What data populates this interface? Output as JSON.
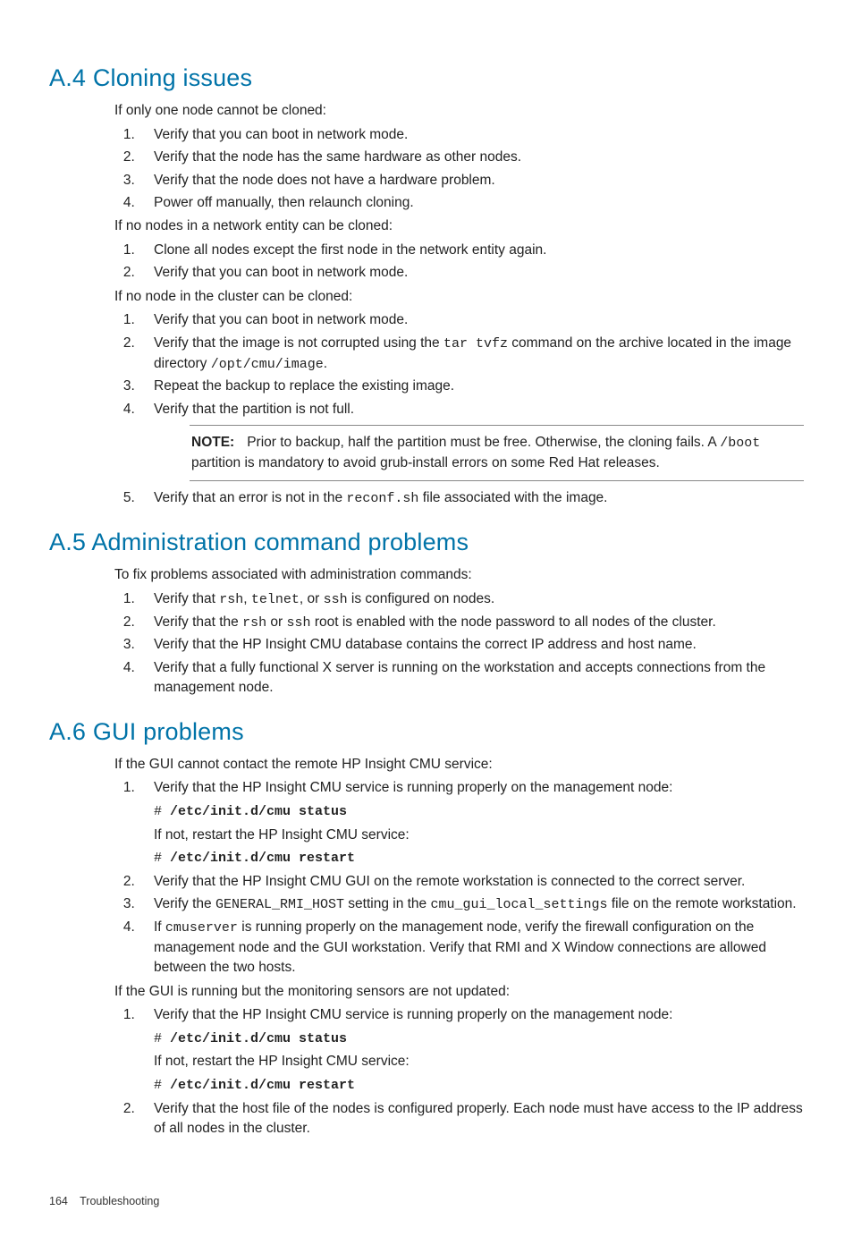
{
  "a4": {
    "heading": "A.4 Cloning issues",
    "p1": "If only one node cannot be cloned:",
    "l1": [
      "Verify that you can boot in network mode.",
      "Verify that the node has the same hardware as other nodes.",
      "Verify that the node does not have a hardware problem.",
      "Power off manually, then relaunch cloning."
    ],
    "p2": "If no nodes in a network entity can be cloned:",
    "l2": [
      "Clone all nodes except the first node in the network entity again.",
      "Verify that you can boot in network mode."
    ],
    "p3": "If no node in the cluster can be cloned:",
    "l3_1": "Verify that you can boot in network mode.",
    "l3_2a": "Verify that the image is not corrupted using the ",
    "l3_2cmd1": "tar tvfz",
    "l3_2b": " command on the archive located in the image directory ",
    "l3_2cmd2": "/opt/cmu/image",
    "l3_2c": ".",
    "l3_3": "Repeat the backup to replace the existing image.",
    "l3_4": "Verify that the partition is not full.",
    "note_label": "NOTE:",
    "note_a": "Prior to backup, half the partition must be free. Otherwise, the cloning fails. A ",
    "note_cmd": "/boot",
    "note_b": " partition is mandatory to avoid grub-install errors on some Red Hat releases.",
    "l3_5a": "Verify that an error is not in the ",
    "l3_5cmd": "reconf.sh",
    "l3_5b": " file associated with the image."
  },
  "a5": {
    "heading": "A.5 Administration command problems",
    "p1": "To fix problems associated with administration commands:",
    "i1a": "Verify that ",
    "i1c1": "rsh",
    "i1b": ", ",
    "i1c2": "telnet",
    "i1c": ", or ",
    "i1c3": "ssh",
    "i1d": " is configured on nodes.",
    "i2a": "Verify that the ",
    "i2c1": "rsh",
    "i2b": " or ",
    "i2c2": "ssh",
    "i2c": " root is enabled with the node password to all nodes of the cluster.",
    "i3": "Verify that the HP Insight CMU database contains the correct IP address and host name.",
    "i4": "Verify that a fully functional X server is running on the workstation and accepts connections from the management node."
  },
  "a6": {
    "heading": "A.6 GUI problems",
    "p1": "If the GUI cannot contact the remote HP Insight CMU service:",
    "i1": "Verify that the HP Insight CMU service is running properly on the management node:",
    "cmd1p": "# ",
    "cmd1": "/etc/init.d/cmu status",
    "i1b": "If not, restart the HP Insight CMU service:",
    "cmd2": "/etc/init.d/cmu restart",
    "i2": "Verify that the HP Insight CMU GUI on the remote workstation is connected to the correct server.",
    "i3a": "Verify the ",
    "i3c1": "GENERAL_RMI_HOST",
    "i3b": " setting in the ",
    "i3c2": "cmu_gui_local_settings",
    "i3c": " file on the remote workstation.",
    "i4a": "If ",
    "i4c1": "cmuserver",
    "i4b": " is running properly on the management node, verify the firewall configuration on the management node and the GUI workstation. Verify that RMI and X Window connections are allowed between the two hosts.",
    "p2": "If the GUI is running but the monitoring sensors are not updated:",
    "j1": "Verify that the HP Insight CMU service is running properly on the management node:",
    "j1b": "If not, restart the HP Insight CMU service:",
    "j2": "Verify that the host file of the nodes is configured properly. Each node must have access to the IP address of all nodes in the cluster."
  },
  "footer": {
    "page": "164",
    "title": "Troubleshooting"
  }
}
